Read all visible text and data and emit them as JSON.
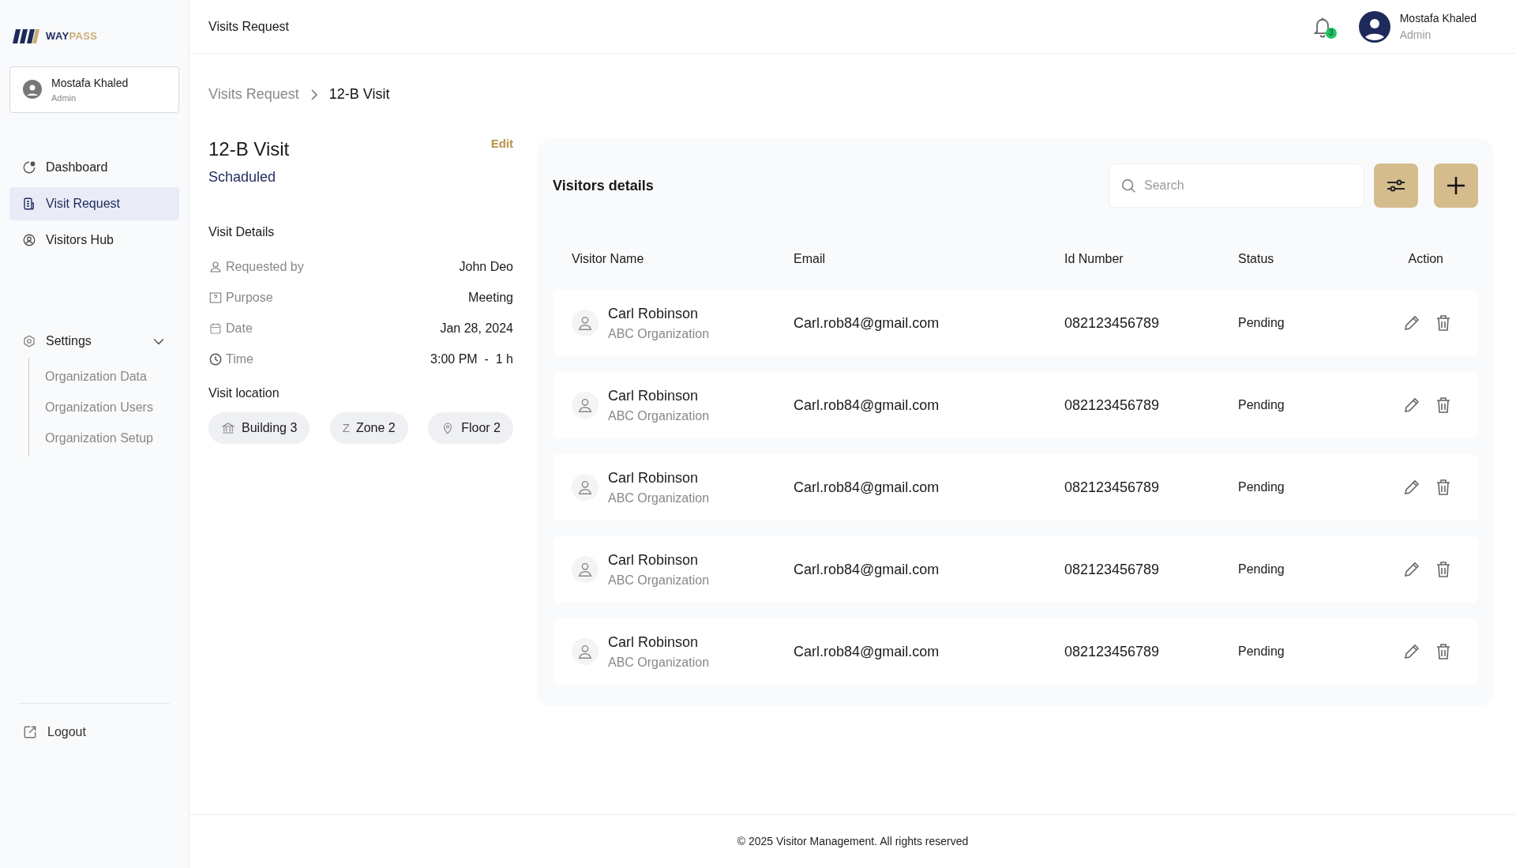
{
  "logo": {
    "primary": "WAY",
    "accent": "PASS"
  },
  "sidebar": {
    "user": {
      "name": "Mostafa Khaled",
      "role": "Admin"
    },
    "nav": [
      {
        "kind": "dashboard",
        "label": "Dashboard",
        "selected": false
      },
      {
        "kind": "document",
        "label": "Visit Request",
        "selected": true
      },
      {
        "kind": "users",
        "label": "Visitors Hub",
        "selected": false
      }
    ],
    "settings": {
      "label": "Settings",
      "expanded": true,
      "children": [
        {
          "label": "Organization Data"
        },
        {
          "label": "Organization Users"
        },
        {
          "label": "Organization Setup"
        }
      ]
    },
    "logout": "Logout"
  },
  "header": {
    "title": "Visits Request",
    "notifications": "3",
    "user": {
      "name": "Mostafa Khaled",
      "role": "Admin"
    }
  },
  "breadcrumb": [
    {
      "label": "Visits Request"
    },
    {
      "label": "12-B Visit"
    }
  ],
  "visit": {
    "title": "12-B Visit",
    "status": "Schaduled",
    "edit": "Edit",
    "details_title": "Visit Details",
    "details": [
      {
        "kind": "person",
        "label": "Requested by",
        "value": "John Deo"
      },
      {
        "kind": "question",
        "label": "Purpose",
        "value": "Meeting"
      },
      {
        "kind": "calendar",
        "label": "Date",
        "value": "Jan 28, 2024"
      },
      {
        "kind": "clock",
        "label": "Time",
        "value": "3:00 PM  -  1 h"
      }
    ],
    "location_title": "Visit location",
    "locations": [
      {
        "kind": "building",
        "label": "Building 3"
      },
      {
        "kind": "letter",
        "icon_text": "Z",
        "label": "Zone 2"
      },
      {
        "kind": "pin",
        "label": "Floor 2"
      }
    ]
  },
  "visitors": {
    "title": "Visitors details",
    "search": {
      "placeholder": "Search"
    },
    "columns": [
      "Visitor Name",
      "Email",
      "Id Number",
      "Status",
      "Action"
    ],
    "rows": [
      {
        "name": "Carl Robinson",
        "organization": "ABC Organization",
        "email": "Carl.rob84@gmail.com",
        "id": "082123456789",
        "status": "Pending"
      },
      {
        "name": "Carl Robinson",
        "organization": "ABC Organization",
        "email": "Carl.rob84@gmail.com",
        "id": "082123456789",
        "status": "Pending"
      },
      {
        "name": "Carl Robinson",
        "organization": "ABC Organization",
        "email": "Carl.rob84@gmail.com",
        "id": "082123456789",
        "status": "Pending"
      },
      {
        "name": "Carl Robinson",
        "organization": "ABC Organization",
        "email": "Carl.rob84@gmail.com",
        "id": "082123456789",
        "status": "Pending"
      },
      {
        "name": "Carl Robinson",
        "organization": "ABC Organization",
        "email": "Carl.rob84@gmail.com",
        "id": "082123456789",
        "status": "Pending"
      }
    ]
  },
  "footer": "© 2025 Visitor Management. All rights reserved"
}
